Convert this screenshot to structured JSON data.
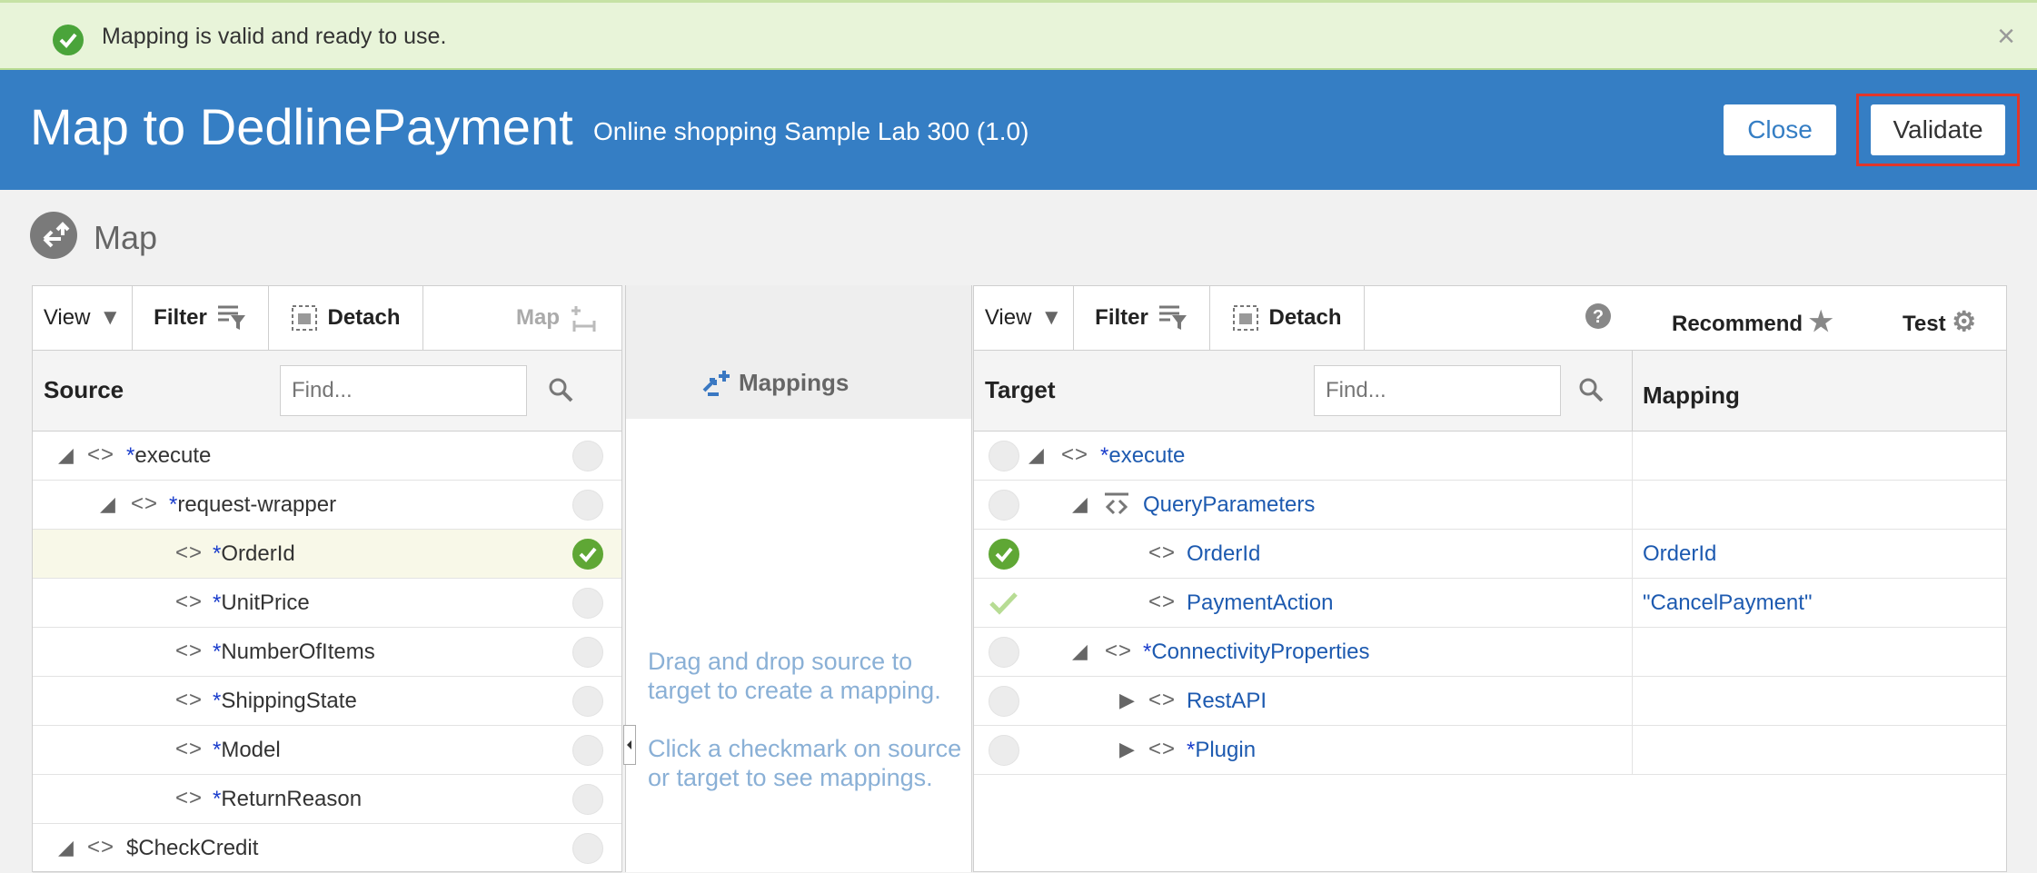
{
  "banner": {
    "message": "Mapping is valid and ready to use.",
    "close": "×"
  },
  "header": {
    "title": "Map to DedlinePayment",
    "subtitle": "Online shopping Sample Lab 300 (1.0)",
    "close_label": "Close",
    "validate_label": "Validate"
  },
  "section": {
    "label": "Map"
  },
  "source_panel": {
    "toolbar": {
      "view": "View",
      "filter": "Filter",
      "detach": "Detach",
      "map": "Map"
    },
    "column": "Source",
    "find_placeholder": "Find...",
    "rows": [
      {
        "star": "*",
        "name": "execute",
        "checked": false
      },
      {
        "star": "*",
        "name": "request-wrapper",
        "checked": false
      },
      {
        "star": "*",
        "name": "OrderId",
        "checked": true
      },
      {
        "star": "*",
        "name": "UnitPrice",
        "checked": false
      },
      {
        "star": "*",
        "name": "NumberOfItems",
        "checked": false
      },
      {
        "star": "*",
        "name": "ShippingState",
        "checked": false
      },
      {
        "star": "*",
        "name": "Model",
        "checked": false
      },
      {
        "star": "*",
        "name": "ReturnReason",
        "checked": false
      },
      {
        "star": "",
        "name": "$CheckCredit",
        "checked": false
      }
    ]
  },
  "mappings_panel": {
    "label": "Mappings",
    "hint1": "Drag and drop source to target to create a mapping.",
    "hint2": "Click a checkmark on source or target to see mappings."
  },
  "target_panel": {
    "toolbar": {
      "view": "View",
      "filter": "Filter",
      "detach": "Detach",
      "recommend": "Recommend",
      "test": "Test"
    },
    "column": "Target",
    "mapping_column": "Mapping",
    "find_placeholder": "Find...",
    "rows": [
      {
        "star": "*",
        "name": "execute",
        "mapping": ""
      },
      {
        "star": "",
        "name": "QueryParameters",
        "mapping": ""
      },
      {
        "star": "",
        "name": "OrderId",
        "mapping": "OrderId"
      },
      {
        "star": "",
        "name": "PaymentAction",
        "mapping": "\"CancelPayment\""
      },
      {
        "star": "*",
        "name": "ConnectivityProperties",
        "mapping": ""
      },
      {
        "star": "",
        "name": "RestAPI",
        "mapping": ""
      },
      {
        "star": "*",
        "name": "Plugin",
        "mapping": ""
      }
    ]
  }
}
